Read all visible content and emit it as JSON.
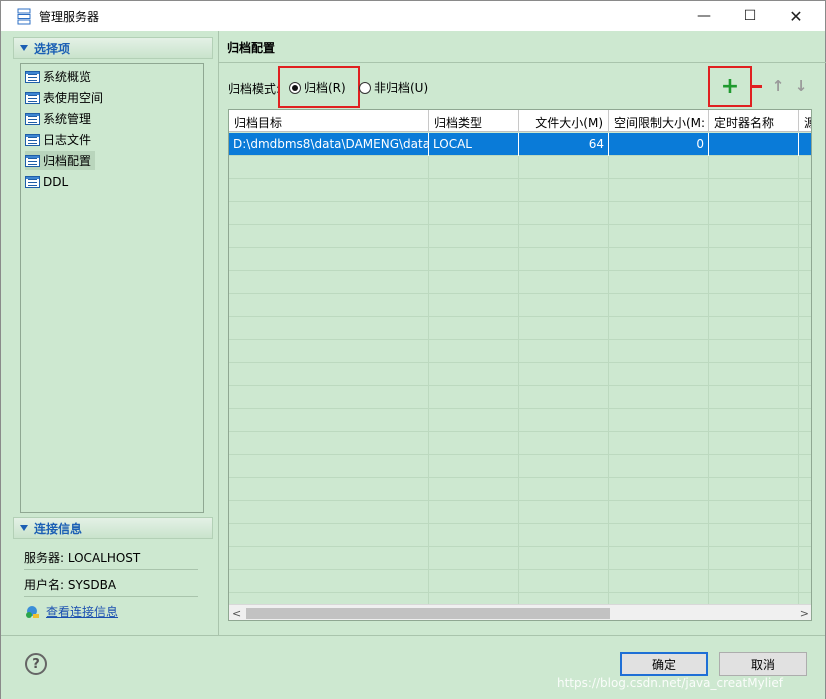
{
  "window": {
    "title": "管理服务器",
    "controls": {
      "minimize": "—",
      "maximize": "☐",
      "close": "✕"
    }
  },
  "sidebar": {
    "section_title": "选择项",
    "items": [
      {
        "label": "系统概览"
      },
      {
        "label": "表使用空间"
      },
      {
        "label": "系统管理"
      },
      {
        "label": "日志文件"
      },
      {
        "label": "归档配置"
      },
      {
        "label": "DDL"
      }
    ],
    "selected_item": "归档配置",
    "connection_title": "连接信息",
    "server_line": "服务器: LOCALHOST",
    "user_line": "用户名: SYSDBA",
    "view_link": "查看连接信息"
  },
  "main": {
    "title": "归档配置",
    "mode_label": "归档模式:",
    "radio_archive": "归档(R)",
    "radio_noarchive": "非归档(U)",
    "selected_mode": "归档(R)",
    "toolbar": {
      "add": "+",
      "up": "↑",
      "down": "↓"
    },
    "table": {
      "columns": [
        "归档目标",
        "归档类型",
        "文件大小(M)",
        "空间限制大小(M:",
        "定时器名称",
        "源"
      ],
      "rows": [
        [
          "D:\\dmdbms8\\data\\DAMENG\\data",
          "LOCAL",
          "64",
          "0",
          "",
          ""
        ]
      ],
      "scroll_left": "<",
      "scroll_right": ">"
    }
  },
  "footer": {
    "help": "?",
    "ok_label": "确定",
    "cancel_label": "取消",
    "watermark": "https://blog.csdn.net/java_creatMylief"
  },
  "colors": {
    "panel_bg": "#cde8d0",
    "selection": "#0a7bd8",
    "accent_blue": "#1b5fb4",
    "highlight_red": "#e02020",
    "add_green": "#1f9a2e"
  }
}
